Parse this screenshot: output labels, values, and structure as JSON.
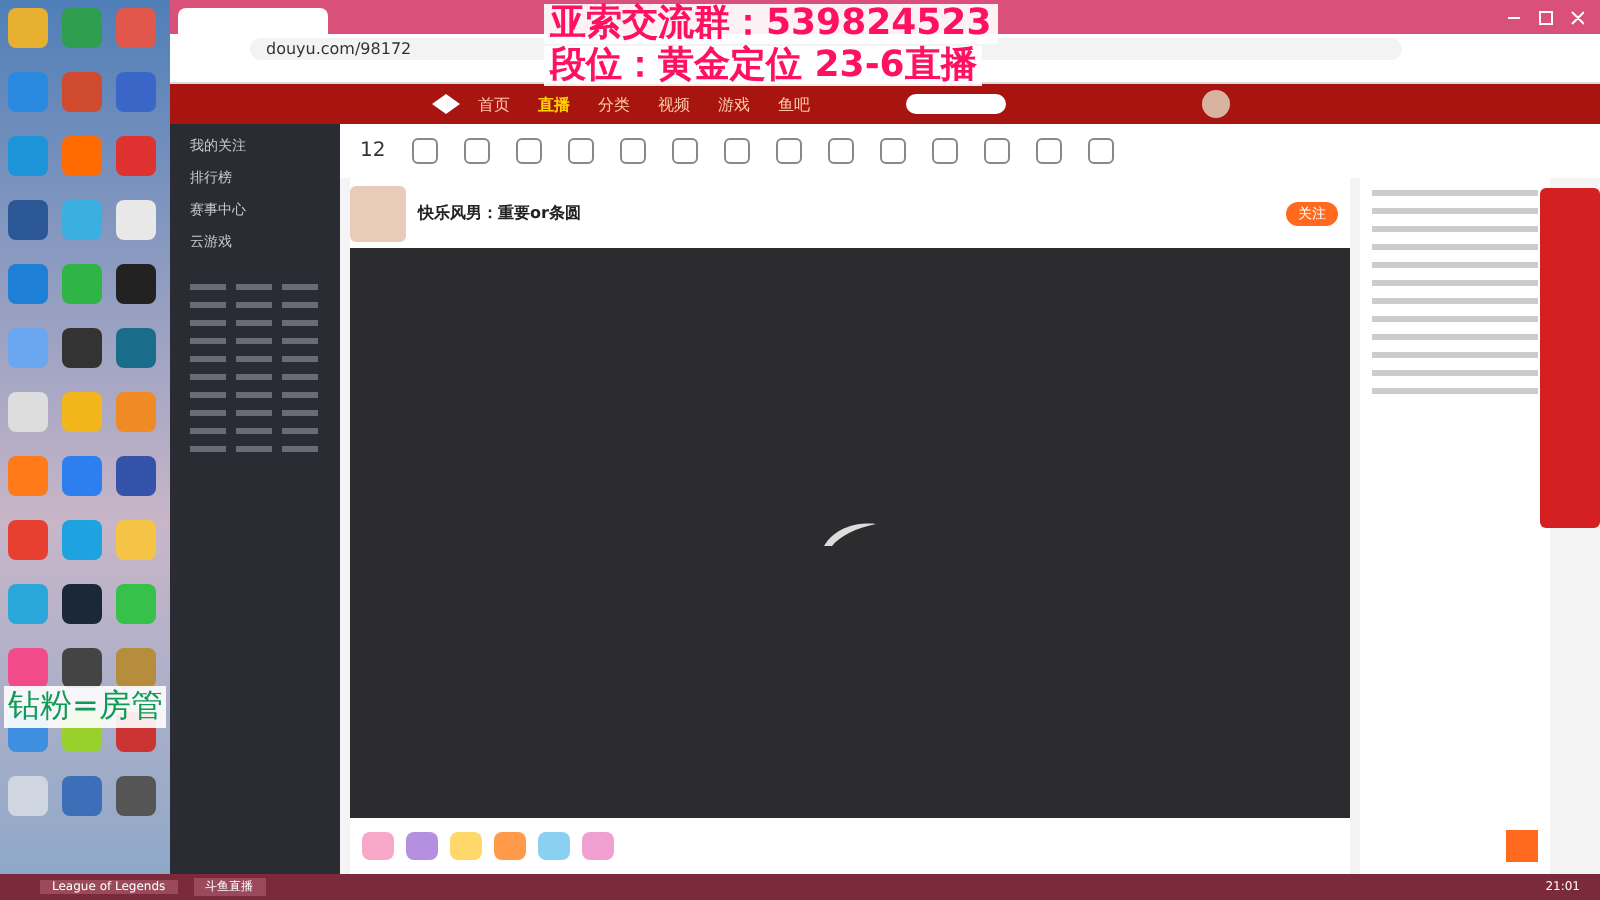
{
  "overlay": {
    "line_1": "亚索交流群：539824523",
    "line_2": "段位：黄金定位 23-6直播",
    "side_note": "钻粉=房管"
  },
  "browser": {
    "url": "douyu.com/98172"
  },
  "site_nav": [
    {
      "label": "首页",
      "selected": false
    },
    {
      "label": "直播",
      "selected": true
    },
    {
      "label": "分类",
      "selected": false
    },
    {
      "label": "视频",
      "selected": false
    },
    {
      "label": "游戏",
      "selected": false
    },
    {
      "label": "鱼吧",
      "selected": false
    }
  ],
  "sidebar": {
    "items": [
      "我的关注",
      "排行榜",
      "赛事中心",
      "云游戏"
    ]
  },
  "stats": {
    "count": "12"
  },
  "stream": {
    "title": "快乐风男：重要or条圆",
    "follow": "关注"
  },
  "taskbar": {
    "apps": [
      "League of Legends",
      "斗鱼直播"
    ],
    "time": "21:01"
  }
}
